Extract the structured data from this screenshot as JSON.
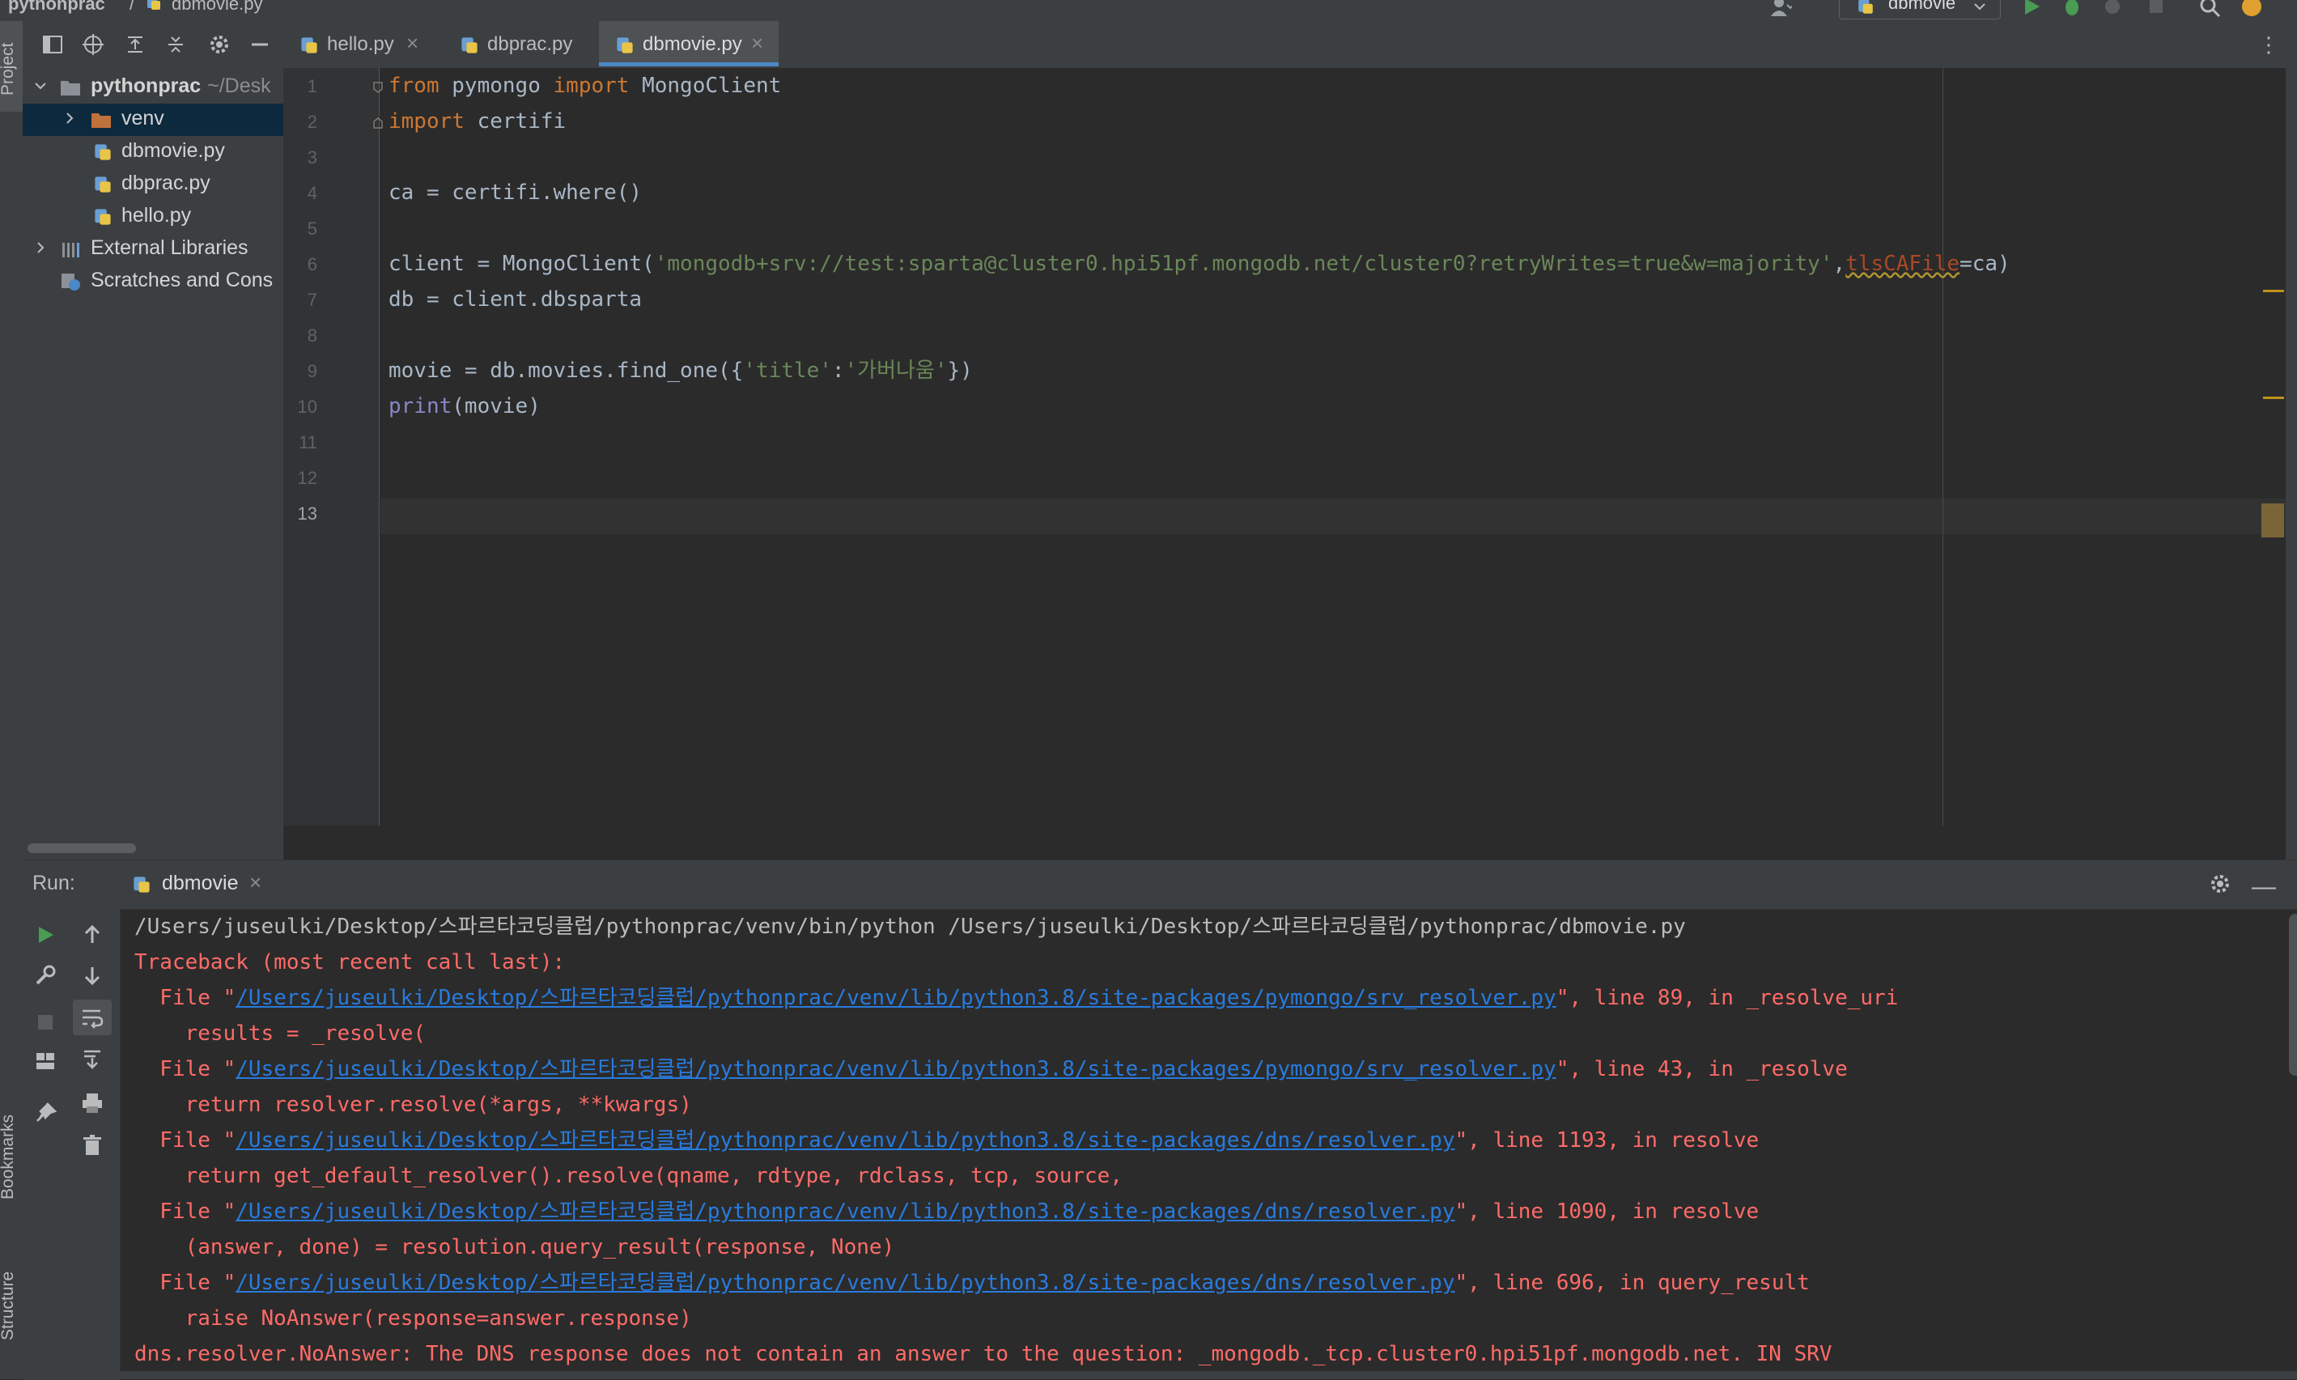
{
  "breadcrumb": {
    "project": "pythonprac",
    "separator": "/",
    "file": "dbmovie.py"
  },
  "toolbar": {
    "run_config": "dbmovie"
  },
  "left_stripe": {
    "project_label": "Project",
    "bookmarks_label": "Bookmarks",
    "structure_label": "Structure"
  },
  "project_tree": [
    {
      "label": "pythonprac",
      "hint": "~/Desk",
      "type": "project-root"
    },
    {
      "label": "venv",
      "type": "folder",
      "selected": true
    },
    {
      "label": "dbmovie.py",
      "type": "python-file"
    },
    {
      "label": "dbprac.py",
      "type": "python-file"
    },
    {
      "label": "hello.py",
      "type": "python-file"
    },
    {
      "label": "External Libraries",
      "type": "libraries"
    },
    {
      "label": "Scratches and Cons",
      "type": "scratches"
    }
  ],
  "tabs": [
    {
      "label": "hello.py",
      "active": false
    },
    {
      "label": "dbprac.py",
      "active": false
    },
    {
      "label": "dbmovie.py",
      "active": true
    }
  ],
  "editor": {
    "line_numbers": [
      "1",
      "2",
      "3",
      "4",
      "5",
      "6",
      "7",
      "8",
      "9",
      "10",
      "11",
      "12",
      "13"
    ],
    "current_line": "13",
    "inspections": {
      "warnings": "4",
      "weak_warnings": "1"
    },
    "code": {
      "l1_kw1": "from",
      "l1_mod": " pymongo ",
      "l1_kw2": "import",
      "l1_name": " MongoClient",
      "l2_kw": "import",
      "l2_mod": " certifi",
      "l4": "ca = certifi.where()",
      "l6_a": "client = MongoClient(",
      "l6_str": "'mongodb+srv://test:sparta@cluster0.hpi51pf.mongodb.net/cluster0?retryWrites=true&w=majority'",
      "l6_comma": ",",
      "l6_param": "tlsCAFile",
      "l6_b": "=ca)",
      "l7": "db = client.dbsparta",
      "l9_a": "movie = db.movies.find_one({",
      "l9_s1": "'title'",
      "l9_colon": ":",
      "l9_s2": "'가버나움'",
      "l9_b": "})",
      "l10_fn": "print",
      "l10_b": "(movie)"
    }
  },
  "run": {
    "title": "Run:",
    "tab_label": "dbmovie",
    "console": {
      "cmd": "/Users/juseulki/Desktop/스파르타코딩클럽/pythonprac/venv/bin/python /Users/juseulki/Desktop/스파르타코딩클럽/pythonprac/dbmovie.py",
      "tb_header": "Traceback (most recent call last):",
      "frames": [
        {
          "prefix": "  File \"",
          "path": "/Users/juseulki/Desktop/스파르타코딩클럽/pythonprac/venv/lib/python3.8/site-packages/pymongo/srv_resolver.py",
          "suffix": "\", line 89, in _resolve_uri",
          "code": "    results = _resolve("
        },
        {
          "prefix": "  File \"",
          "path": "/Users/juseulki/Desktop/스파르타코딩클럽/pythonprac/venv/lib/python3.8/site-packages/pymongo/srv_resolver.py",
          "suffix": "\", line 43, in _resolve",
          "code": "    return resolver.resolve(*args, **kwargs)"
        },
        {
          "prefix": "  File \"",
          "path": "/Users/juseulki/Desktop/스파르타코딩클럽/pythonprac/venv/lib/python3.8/site-packages/dns/resolver.py",
          "suffix": "\", line 1193, in resolve",
          "code": "    return get_default_resolver().resolve(qname, rdtype, rdclass, tcp, source,"
        },
        {
          "prefix": "  File \"",
          "path": "/Users/juseulki/Desktop/스파르타코딩클럽/pythonprac/venv/lib/python3.8/site-packages/dns/resolver.py",
          "suffix": "\", line 1090, in resolve",
          "code": "    (answer, done) = resolution.query_result(response, None)"
        },
        {
          "prefix": "  File \"",
          "path": "/Users/juseulki/Desktop/스파르타코딩클럽/pythonprac/venv/lib/python3.8/site-packages/dns/resolver.py",
          "suffix": "\", line 696, in query_result",
          "code": "    raise NoAnswer(response=answer.response)"
        }
      ],
      "error": "dns.resolver.NoAnswer: The DNS response does not contain an answer to the question: _mongodb._tcp.cluster0.hpi51pf.mongodb.net. IN SRV"
    }
  },
  "colors": {
    "background": "#2b2b2b",
    "panel": "#3c3f41",
    "keyword": "#cc7832",
    "string": "#6a8759",
    "error_text": "#ff6b68",
    "link": "#287bde",
    "accent": "#4a88c7"
  },
  "icons": [
    "folder-icon",
    "python-file-icon",
    "run-icon",
    "debug-icon",
    "search-icon",
    "gear-icon",
    "close-icon",
    "chevron-right-icon",
    "chevron-down-icon",
    "warning-icon",
    "check-icon",
    "wrap-icon",
    "scroll-to-end-icon",
    "print-icon",
    "trash-icon",
    "pin-icon",
    "wrench-icon",
    "arrow-up-icon",
    "arrow-down-icon",
    "stop-icon",
    "layout-icon",
    "locate-icon",
    "expand-all-icon",
    "collapse-all-icon",
    "minimize-icon",
    "more-icon"
  ]
}
